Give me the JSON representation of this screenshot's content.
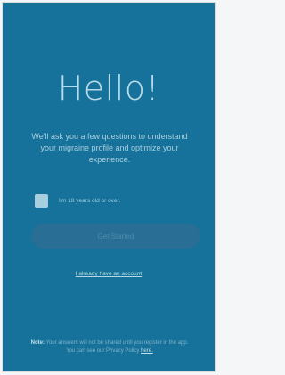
{
  "welcome": {
    "title": "Hello!",
    "intro": "We'll ask you a few questions to understand your migraine profile and optimize your experience."
  },
  "age_check": {
    "label": "I'm 18 years old or over.",
    "checked": false
  },
  "start_button": {
    "label": "Get Started",
    "enabled": false
  },
  "account_link": {
    "label": "I already have an account"
  },
  "note": {
    "label": "Note:",
    "text": "Your answers will not be shared until you register in the app. You can see our Privacy Policy",
    "link": "here."
  },
  "colors": {
    "background": "#16729a",
    "button_disabled": "#296e94",
    "text_light": "#b9dbe8"
  }
}
